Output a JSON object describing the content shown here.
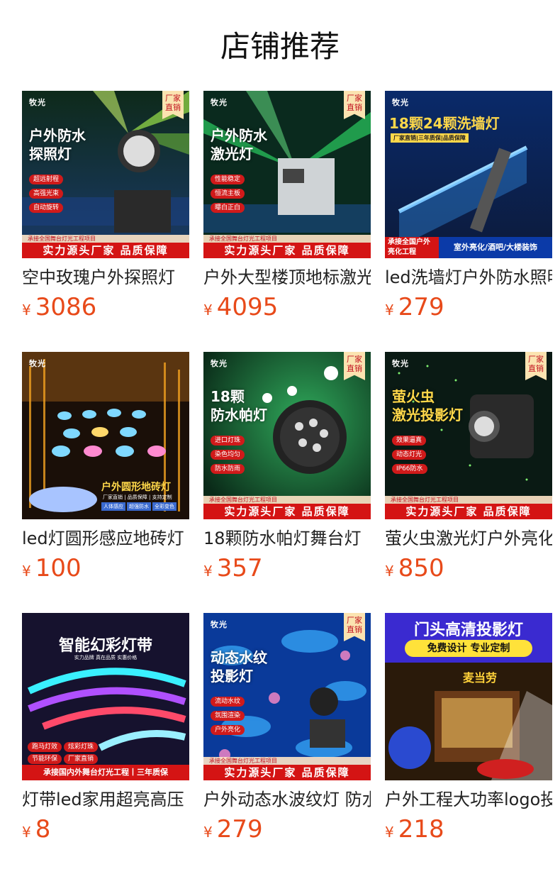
{
  "page": {
    "title": "店铺推荐"
  },
  "currency": "¥",
  "products": [
    {
      "name": "空中玫瑰户外探照灯",
      "price": "3086",
      "brand": "牧光",
      "corner": "厂家直销",
      "headline": [
        "户外防水",
        "探照灯"
      ],
      "features": [
        "超远射程",
        "高强光束",
        "自动旋转"
      ],
      "subnote": "承接全国舞台灯光工程项目",
      "footer": "实力源头厂家 品质保障"
    },
    {
      "name": "户外大型楼顶地标激光灯",
      "price": "4095",
      "brand": "牧光",
      "corner": "厂家直销",
      "headline": [
        "户外防水",
        "激光灯"
      ],
      "features": [
        "性能稳定",
        "恒流主板",
        "曝白正白"
      ],
      "subnote": "承接全国舞台灯光工程项目",
      "footer": "实力源头厂家 品质保障"
    },
    {
      "name": "led洗墙灯户外防水照明",
      "price": "279",
      "brand": "牧光",
      "headline": [
        "18颗24颗洗墙灯"
      ],
      "tagline": "厂家直销|三年质保|品质保障",
      "bottom_left": "承接全国户外亮化工程",
      "bottom_right": "室外亮化/酒吧/大楼装饰"
    },
    {
      "name": "led灯圆形感应地砖灯",
      "price": "100",
      "brand": "牧光",
      "headline": [
        "户外圆形地砖灯"
      ],
      "tagline": "厂家直销 | 品质保障 | 支持定制",
      "chips": [
        "人体感应",
        "超强防水",
        "全彩变色"
      ]
    },
    {
      "name": "18颗防水帕灯舞台灯",
      "price": "357",
      "brand": "牧光",
      "corner": "厂家直销",
      "headline": [
        "18颗",
        "防水帕灯"
      ],
      "features": [
        "进口灯珠",
        "染色均匀",
        "防水防雨"
      ],
      "subnote": "承接全国舞台灯光工程项目",
      "footer": "实力源头厂家 品质保障"
    },
    {
      "name": "萤火虫激光灯户外亮化",
      "price": "850",
      "brand": "牧光",
      "corner": "厂家直销",
      "headline": [
        "萤火虫",
        "激光投影灯"
      ],
      "features": [
        "效果逼真",
        "动态灯光",
        "IP66防水"
      ],
      "subnote": "承接全国舞台灯光工程项目",
      "footer": "实力源头厂家 品质保障"
    },
    {
      "name": "灯带led家用超亮高压",
      "price": "8",
      "headline": [
        "智能幻彩灯带"
      ],
      "tagline": "实力品牌 真在品质 实惠价格",
      "features": [
        "跑马灯效",
        "炫彩灯珠",
        "节能环保",
        "厂家直销"
      ],
      "footer": "承接国内外舞台灯光工程丨三年质保"
    },
    {
      "name": "户外动态水波纹灯 防水",
      "price": "279",
      "brand": "牧光",
      "corner": "厂家直销",
      "headline": [
        "动态水纹",
        "投影灯"
      ],
      "features": [
        "流动水纹",
        "氛围渲染",
        "户外亮化"
      ],
      "subnote": "承接全国舞台灯光工程项目",
      "footer": "实力源头厂家 品质保障"
    },
    {
      "name": "户外工程大功率logo投影灯",
      "price": "218",
      "headline": [
        "门头高清投影灯"
      ],
      "tagline": "免费设计 专业定制",
      "sign": "麦当劳"
    }
  ],
  "colors": {
    "price": "#e84a1a",
    "footer_red": "#d41414",
    "accent": "#c1121f"
  },
  "icons": [
    "brand-logo-icon",
    "corner-badge-icon"
  ]
}
